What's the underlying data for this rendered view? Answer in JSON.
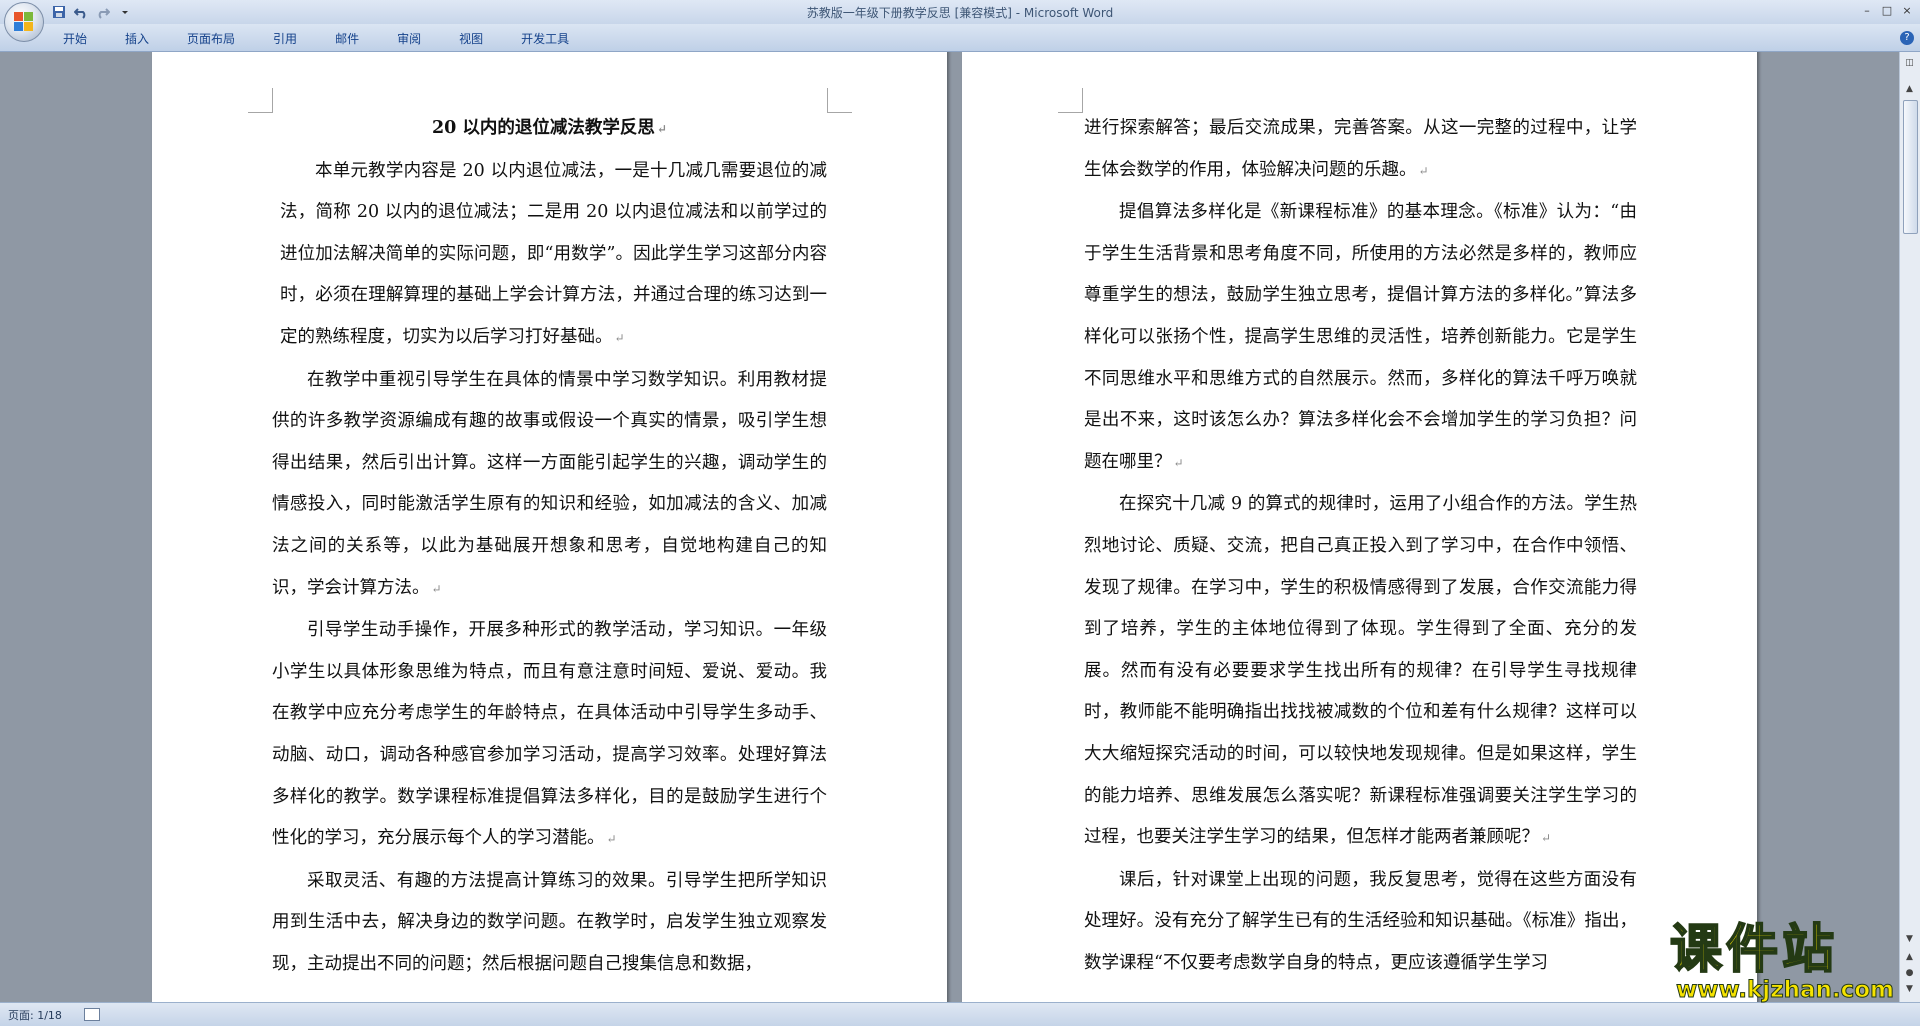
{
  "window": {
    "title": "苏教版一年级下册教学反思 [兼容模式] - Microsoft Word",
    "controls": [
      "–",
      "□",
      "×"
    ]
  },
  "quick_access": [
    "save-icon",
    "undo-icon",
    "redo-icon",
    "customize-icon"
  ],
  "ribbon": {
    "tabs": [
      "开始",
      "插入",
      "页面布局",
      "引用",
      "邮件",
      "审阅",
      "视图",
      "开发工具"
    ],
    "help_label": "?"
  },
  "document": {
    "left_page": {
      "title": "20 以内的退位减法教学反思",
      "paragraphs": [
        "本单元教学内容是 20 以内退位减法，一是十几减几需要退位的减法，简称 20 以内的退位减法；二是用 20 以内退位减法和以前学过的进位加法解决简单的实际问题，即“用数学”。因此学生学习这部分内容时，必须在理解算理的基础上学会计算方法，并通过合理的练习达到一定的熟练程度，切实为以后学习打好基础。",
        "在教学中重视引导学生在具体的情景中学习数学知识。利用教材提供的许多教学资源编成有趣的故事或假设一个真实的情景，吸引学生想得出结果，然后引出计算。这样一方面能引起学生的兴趣，调动学生的情感投入，同时能激活学生原有的知识和经验，如加减法的含义、加减法之间的关系等，以此为基础展开想象和思考，自觉地构建自己的知识，学会计算方法。",
        "引导学生动手操作，开展多种形式的教学活动，学习知识。一年级小学生以具体形象思维为特点，而且有意注意时间短、爱说、爱动。我在教学中应充分考虑学生的年龄特点，在具体活动中引导学生多动手、动脑、动口，调动各种感官参加学习活动，提高学习效率。处理好算法多样化的教学。数学课程标准提倡算法多样化，目的是鼓励学生进行个性化的学习，充分展示每个人的学习潜能。",
        "采取灵活、有趣的方法提高计算练习的效果。引导学生把所学知识用到生活中去，解决身边的数学问题。在教学时，启发学生独立观察发现，主动提出不同的问题；然后根据问题自己搜集信息和数据，"
      ]
    },
    "right_page": {
      "paragraphs": [
        "进行探索解答；最后交流成果，完善答案。从这一完整的过程中，让学生体会数学的作用，体验解决问题的乐趣。",
        "提倡算法多样化是《新课程标准》的基本理念。《标准》认为：“由于学生生活背景和思考角度不同，所使用的方法必然是多样的，教师应尊重学生的想法，鼓励学生独立思考，提倡计算方法的多样化。”算法多样化可以张扬个性，提高学生思维的灵活性，培养创新能力。它是学生不同思维水平和思维方式的自然展示。然而，多样化的算法千呼万唤就是出不来，这时该怎么办？算法多样化会不会增加学生的学习负担？问题在哪里？",
        "在探究十几减 9 的算式的规律时，运用了小组合作的方法。学生热烈地讨论、质疑、交流，把自己真正投入到了学习中，在合作中领悟、发现了规律。在学习中，学生的积极情感得到了发展，合作交流能力得到了培养，学生的主体地位得到了体现。学生得到了全面、充分的发展。然而有没有必要要求学生找出所有的规律？在引导学生寻找规律时，教师能不能明确指出找找被减数的个位和差有什么规律？这样可以大大缩短探究活动的时间，可以较快地发现规律。但是如果这样，学生的能力培养、思维发展怎么落实呢？新课程标准强调要关注学生学习的过程，也要关注学生学习的结果，但怎样才能两者兼顾呢？",
        "课后，针对课堂上出现的问题，我反复思考，觉得在这些方面没有处理好。没有充分了解学生已有的生活经验和知识基础。《标准》指出，数学课程“不仅要考虑数学自身的特点，更应该遵循学生学习"
      ]
    },
    "paragraph_mark": "↵"
  },
  "statusbar": {
    "page_indicator": "页面: 1/18"
  },
  "watermark": {
    "text": "课件站",
    "url": "www.kjzhan.com"
  }
}
